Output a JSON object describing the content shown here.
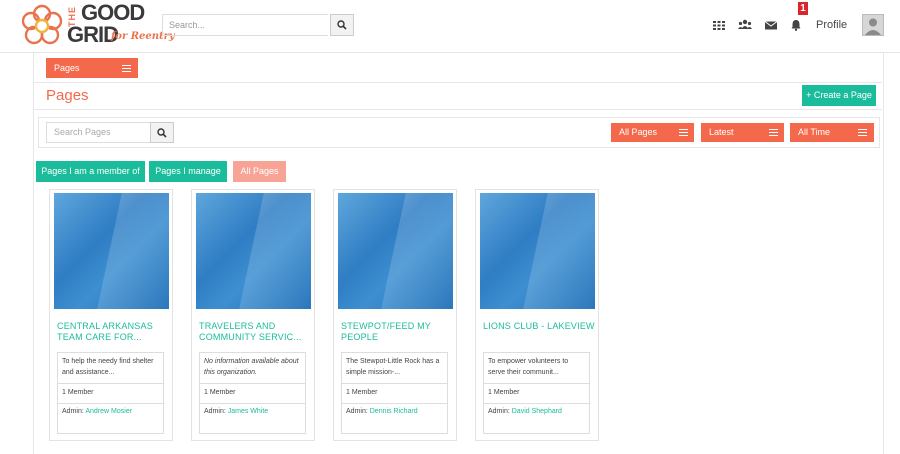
{
  "header": {
    "logo": {
      "the": "THE",
      "good": "GOOD",
      "grid": "GRID",
      "tagline": "for Reentry"
    },
    "search": {
      "placeholder": "Search..."
    },
    "nav_icons": [
      "apps-grid-icon",
      "groups-icon",
      "mail-icon",
      "bell-icon"
    ],
    "notification_count": "1",
    "profile_label": "Profile"
  },
  "subnav": {
    "pages_label": "Pages"
  },
  "page": {
    "title": "Pages",
    "create_label": "+ Create a Page"
  },
  "filters": {
    "search_placeholder": "Search Pages",
    "dropdowns": [
      {
        "label": "All Pages"
      },
      {
        "label": "Latest"
      },
      {
        "label": "All Time"
      }
    ]
  },
  "tabs": [
    {
      "label": "Pages I am a member of",
      "active": false
    },
    {
      "label": "Pages I manage",
      "active": false
    },
    {
      "label": "All Pages",
      "active": true
    }
  ],
  "cards": [
    {
      "title": "CENTRAL ARKANSAS TEAM CARE FOR...",
      "description": "To help the needy find shelter and assistance...",
      "italic": false,
      "members": "1 Member",
      "admin_prefix": "Admin:",
      "admin_name": "Andrew Mosier"
    },
    {
      "title": "TRAVELERS AND COMMUNITY SERVIC...",
      "description": "No information available about this organization.",
      "italic": true,
      "members": "1 Member",
      "admin_prefix": "Admin:",
      "admin_name": "James White"
    },
    {
      "title": "STEWPOT/FEED MY PEOPLE",
      "description": "The Stewpot-Little Rock has a simple mission-...",
      "italic": false,
      "members": "1 Member",
      "admin_prefix": "Admin:",
      "admin_name": "Dennis Richard"
    },
    {
      "title": "LIONS CLUB - LAKEVIEW",
      "description": "To empower volunteers to serve their communit...",
      "italic": false,
      "members": "1 Member",
      "admin_prefix": "Admin:",
      "admin_name": "David Shephard"
    }
  ],
  "colors": {
    "accent": "#f4694c",
    "teal": "#1bbc9b",
    "tab_active": "#f7a395"
  }
}
